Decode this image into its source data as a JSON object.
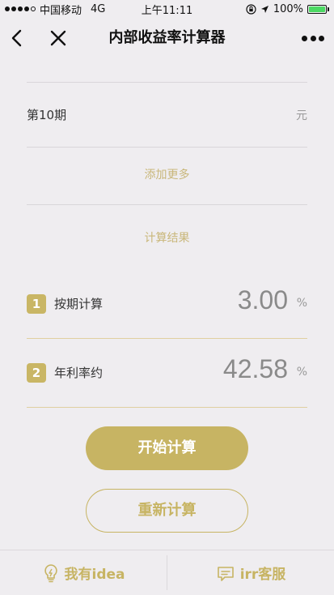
{
  "status_bar": {
    "carrier": "中国移动",
    "network": "4G",
    "time": "上午11:11",
    "battery_text": "100%",
    "battery_level": 1.0
  },
  "nav": {
    "title": "内部收益率计算器"
  },
  "period": {
    "label": "第10期",
    "unit": "元"
  },
  "add_more": "添加更多",
  "result_title": "计算结果",
  "results": [
    {
      "badge": "1",
      "label": "按期计算",
      "value": "3.00",
      "unit": "%"
    },
    {
      "badge": "2",
      "label": "年利率约",
      "value": "42.58",
      "unit": "%"
    }
  ],
  "buttons": {
    "start": "开始计算",
    "reset": "重新计算"
  },
  "bottom": {
    "idea_label": "我有idea",
    "service_label": "irr客服"
  },
  "colors": {
    "accent": "#c7b463",
    "background": "#efedf0",
    "battery_green": "#4cd964"
  },
  "icons": [
    "back-icon",
    "close-icon",
    "more-icon",
    "lightbulb-icon",
    "chat-icon"
  ]
}
